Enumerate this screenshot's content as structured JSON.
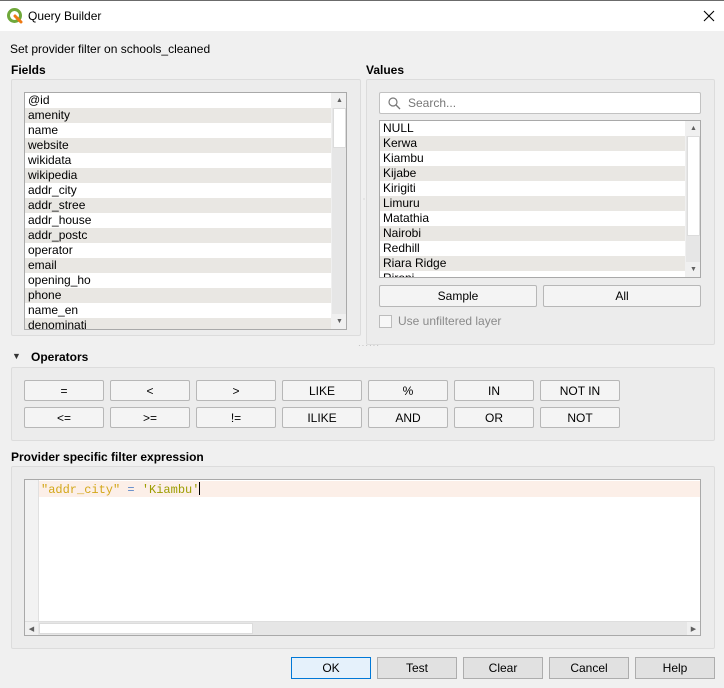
{
  "window": {
    "title": "Query Builder",
    "app_icon": "qgis-logo-icon",
    "close_icon": "close-icon"
  },
  "subtitle": "Set provider filter on schools_cleaned",
  "fields": {
    "label": "Fields",
    "items": [
      "@id",
      "amenity",
      "name",
      "website",
      "wikidata",
      "wikipedia",
      "addr_city",
      "addr_stree",
      "addr_house",
      "addr_postc",
      "operator",
      "email",
      "opening_ho",
      "phone",
      "name_en",
      "denominati"
    ]
  },
  "values": {
    "label": "Values",
    "search_placeholder": "Search...",
    "search_value": "",
    "items": [
      "NULL",
      "Kerwa",
      "Kiambu",
      "Kijabe",
      "Kirigiti",
      "Limuru",
      "Matathia",
      "Nairobi",
      "Redhill",
      "Riara Ridge",
      "Rironi"
    ],
    "sample_label": "Sample",
    "all_label": "All",
    "use_unfiltered_label": "Use unfiltered layer",
    "use_unfiltered_checked": false
  },
  "operators": {
    "label": "Operators",
    "row1": [
      "=",
      "<",
      ">",
      "LIKE",
      "%",
      "IN",
      "NOT IN"
    ],
    "row2": [
      "<=",
      ">=",
      "!=",
      "ILIKE",
      "AND",
      "OR",
      "NOT"
    ]
  },
  "expression": {
    "label": "Provider specific filter expression",
    "tokens": {
      "field": "\"addr_city\"",
      "op": " = ",
      "str": "'Kiambu'"
    }
  },
  "buttons": {
    "ok": "OK",
    "test": "Test",
    "clear": "Clear",
    "cancel": "Cancel",
    "help": "Help"
  },
  "colors": {
    "field_token": "#d3a719",
    "operator_token": "#5a86c9",
    "string_token": "#9d9d00",
    "default_button_border": "#0078d7"
  }
}
